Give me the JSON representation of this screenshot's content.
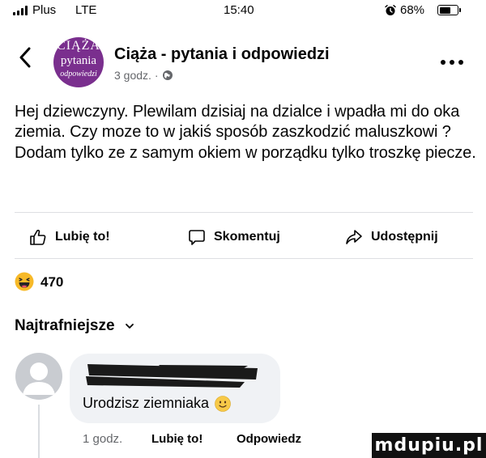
{
  "status_bar": {
    "carrier": "Plus",
    "network": "LTE",
    "time": "15:40",
    "battery_percent": "68%",
    "battery_level": 0.68,
    "signal_icon": "signal-bars-icon",
    "alarm_icon": "alarm-icon"
  },
  "header": {
    "back_icon": "chevron-left-icon",
    "avatar_lines": [
      "CIĄŻA",
      "pytania",
      "odpowiedzi"
    ],
    "group_name": "Ciąża - pytania i odpowiedzi",
    "timestamp": "3 godz. ·",
    "privacy_icon": "globe-icon",
    "more_icon": "more-horizontal-icon"
  },
  "post": {
    "text": "Hej dziewczyny. Plewilam dzisiaj na dzialce i wpadła mi do oka ziemia. Czy moze to w jakiś sposób zaszkodzić maluszkowi ? Dodam tylko ze z samym okiem w porządku tylko troszkę piecze."
  },
  "actions": {
    "like": "Lubię to!",
    "comment": "Skomentuj",
    "share": "Udostępnij"
  },
  "reactions": {
    "emoji_icon": "haha-emoji-icon",
    "count": "470"
  },
  "comments_sort": {
    "label": "Najtrafniejsze",
    "icon": "chevron-down-icon"
  },
  "comment": {
    "text": "Urodzisz ziemniaka",
    "emoji_icon": "smiling-face-emoji-icon",
    "time": "1 godz.",
    "like": "Lubię to!",
    "reply": "Odpowiedz"
  },
  "watermark": {
    "text": "mdupiu.pl"
  },
  "colors": {
    "text": "#050505",
    "secondary_text": "#65676b",
    "bubble": "#f0f2f5",
    "divider": "#dddfe2",
    "avatar_purple": "#7a2f8e",
    "redaction": "#1a1a1a"
  }
}
